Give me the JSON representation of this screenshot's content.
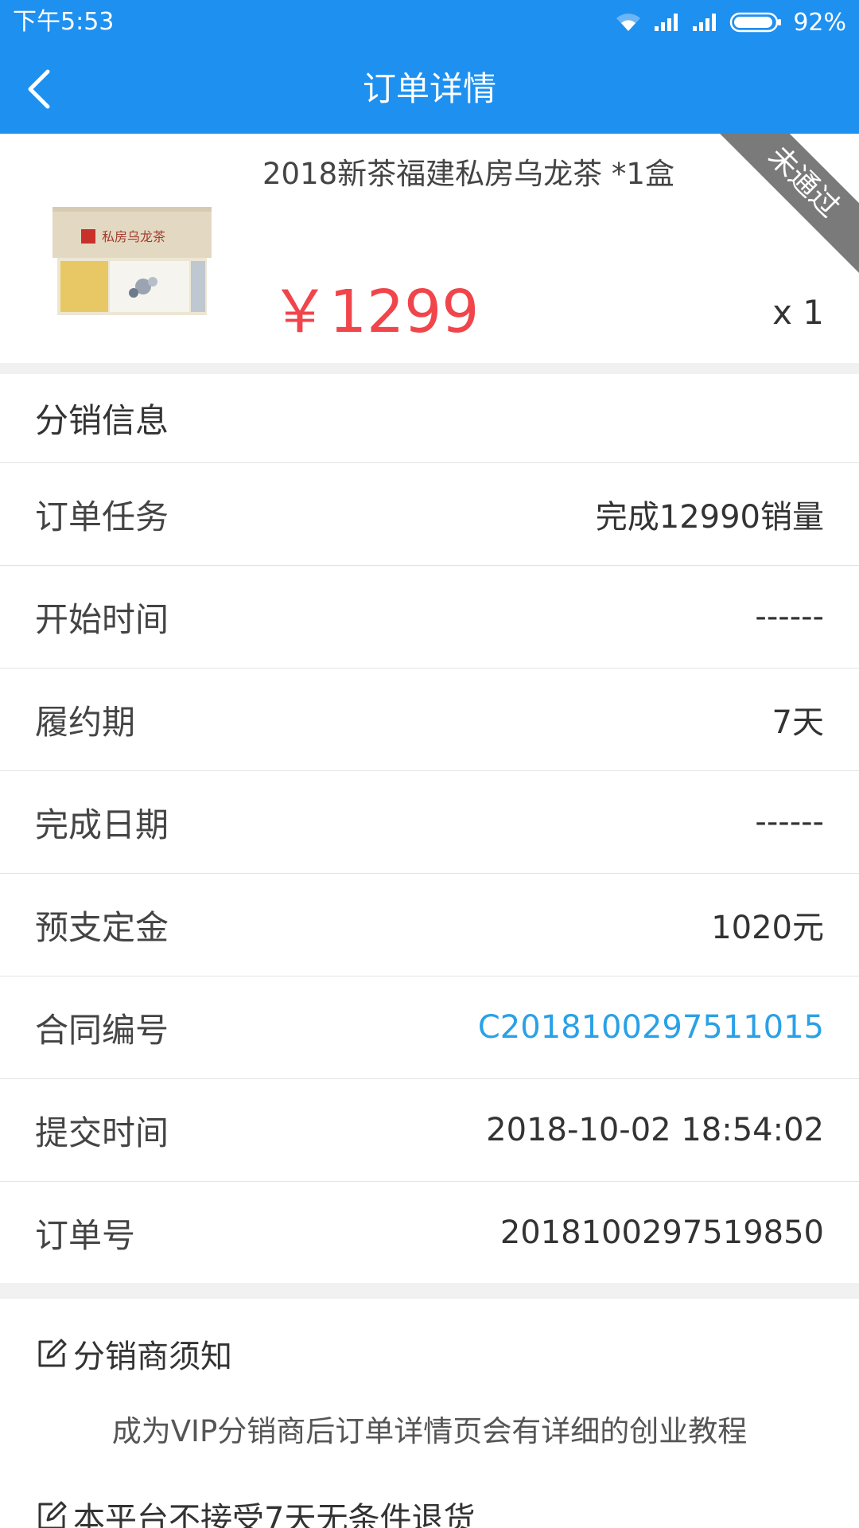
{
  "status_bar": {
    "time": "下午5:53",
    "battery": "92%"
  },
  "app_bar": {
    "title": "订单详情"
  },
  "product": {
    "name": "2018新茶福建私房乌龙茶 *1盒",
    "price": "￥1299",
    "quantity": "x 1",
    "ribbon": "未通过",
    "thumb_text": "私房乌龙茶"
  },
  "info": {
    "header": "分销信息",
    "rows": [
      {
        "label": "订单任务",
        "value": "完成12990销量"
      },
      {
        "label": "开始时间",
        "value": "------"
      },
      {
        "label": "履约期",
        "value": "7天"
      },
      {
        "label": "完成日期",
        "value": "------"
      },
      {
        "label": "预支定金",
        "value": "1020元"
      },
      {
        "label": "合同编号",
        "value": "C2018100297511015"
      },
      {
        "label": "提交时间",
        "value": "2018-10-02 18:54:02"
      },
      {
        "label": "订单号",
        "value": "2018100297519850"
      }
    ]
  },
  "notices": {
    "title1": "分销商须知",
    "text1": "成为VIP分销商后订单详情页会有详细的创业教程",
    "title2": "本平台不接受7天无条件退货"
  },
  "colors": {
    "primary": "#1E90F0",
    "price": "#F0454B",
    "link": "#2AA1E6",
    "ribbon": "#7A7A7A"
  }
}
